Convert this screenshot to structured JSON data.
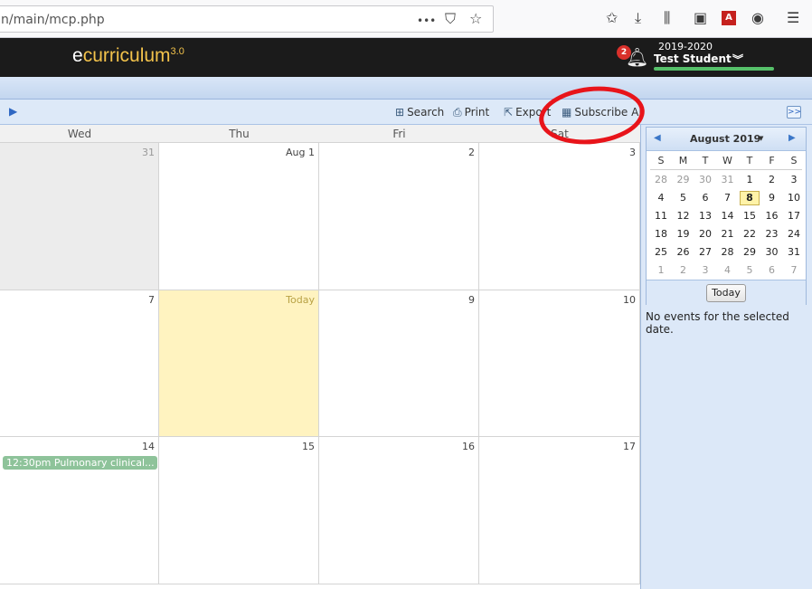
{
  "browser": {
    "url": "n/main/mcp.php",
    "more": "•••",
    "pocket": "⛉",
    "star": "☆",
    "pdf": "A"
  },
  "header": {
    "logo_e": "e",
    "logo_main": "curriculum",
    "logo_version": "3.0",
    "notification_count": "2",
    "year": "2019-2020",
    "student": "Test Student",
    "chevron": "»"
  },
  "toolbar": {
    "search": "Search",
    "print": "Print",
    "export": "Export",
    "subscribe_all": "Subscribe All",
    "collapse": ">>"
  },
  "calendar": {
    "day_headers": [
      "Wed",
      "Thu",
      "Fri",
      "Sat"
    ],
    "rows": [
      [
        "31",
        "Aug 1",
        "2",
        "3"
      ],
      [
        "7",
        "Today",
        "9",
        "10"
      ],
      [
        "14",
        "15",
        "16",
        "17"
      ]
    ],
    "event": "12:30pm Pulmonary clinical..."
  },
  "mini_calendar": {
    "title": "August 2019",
    "dow": [
      "S",
      "M",
      "T",
      "W",
      "T",
      "F",
      "S"
    ],
    "weeks": [
      [
        "28",
        "29",
        "30",
        "31",
        "1",
        "2",
        "3"
      ],
      [
        "4",
        "5",
        "6",
        "7",
        "8",
        "9",
        "10"
      ],
      [
        "11",
        "12",
        "13",
        "14",
        "15",
        "16",
        "17"
      ],
      [
        "18",
        "19",
        "20",
        "21",
        "22",
        "23",
        "24"
      ],
      [
        "25",
        "26",
        "27",
        "28",
        "29",
        "30",
        "31"
      ],
      [
        "1",
        "2",
        "3",
        "4",
        "5",
        "6",
        "7"
      ]
    ],
    "today_button": "Today",
    "no_events": "No events for the selected date."
  },
  "colors": {
    "today_cell": "#fff3c0",
    "event": "#8ec39a",
    "annotation": "#e8141a",
    "logo": "#f2c24b"
  }
}
